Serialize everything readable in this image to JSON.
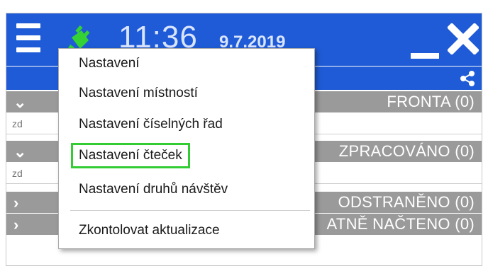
{
  "titlebar": {
    "time": "11:36",
    "date": "9.7.2019",
    "colors": {
      "bar": "#1f5bd6",
      "plug": "#35d235"
    }
  },
  "sections": [
    {
      "title": "FRONTA (0)",
      "expanded": true
    },
    {
      "title": "ZPRACOVÁNO (0)",
      "expanded": true
    },
    {
      "title": "ODSTRANĚNO (0)",
      "expanded": false
    },
    {
      "title": "ATNĚ NAČTENO (0)",
      "expanded": false
    }
  ],
  "filters": [
    {
      "placeholder": "zd"
    },
    {
      "placeholder": "zd"
    }
  ],
  "menu": {
    "items": [
      "Nastavení",
      "Nastavení místností",
      "Nastavení číselných řad",
      "Nastavení čteček",
      "Nastavení druhů návštěv",
      "Zkontolovat aktualizace"
    ],
    "highlighted_index": 3,
    "highlight_color": "#32cd32"
  }
}
